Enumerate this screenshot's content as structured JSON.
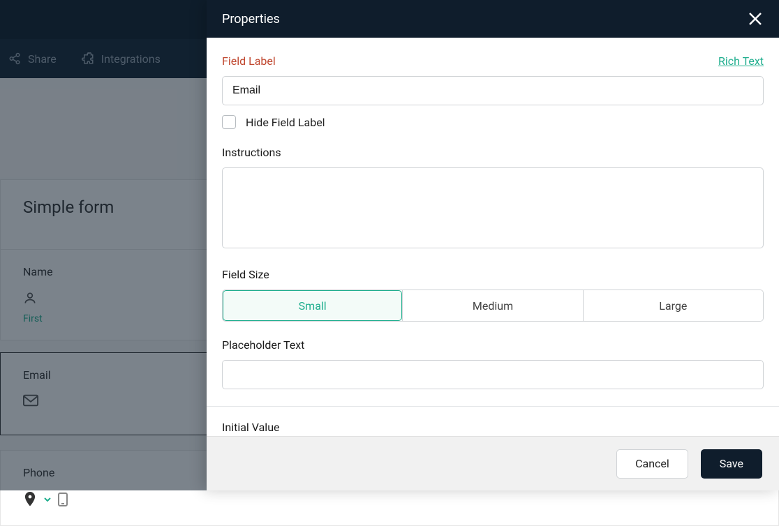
{
  "nav": {
    "share": "Share",
    "integrations": "Integrations"
  },
  "form": {
    "title": "Simple form",
    "fields": {
      "name": {
        "label": "Name",
        "sub": "First"
      },
      "email": {
        "label": "Email"
      },
      "phone": {
        "label": "Phone"
      }
    }
  },
  "panel": {
    "title": "Properties",
    "field_label_label": "Field Label",
    "field_label_value": "Email",
    "rich_text_link": "Rich Text",
    "hide_label": "Hide Field Label",
    "instructions_label": "Instructions",
    "instructions_value": "",
    "field_size_label": "Field Size",
    "sizes": {
      "small": "Small",
      "medium": "Medium",
      "large": "Large"
    },
    "selected_size": "small",
    "placeholder_label": "Placeholder Text",
    "placeholder_value": "",
    "initial_value_label": "Initial Value",
    "footer": {
      "cancel": "Cancel",
      "save": "Save"
    }
  }
}
